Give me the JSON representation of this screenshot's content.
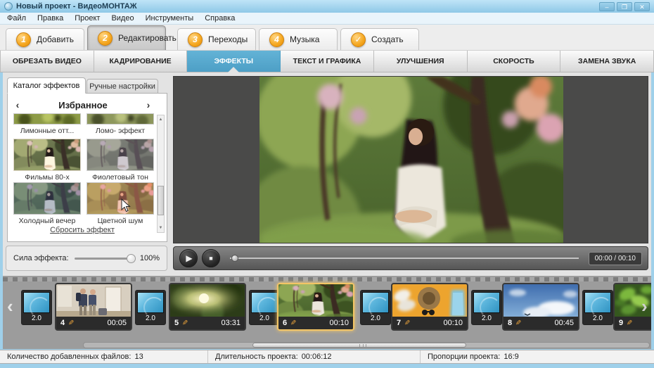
{
  "window": {
    "title": "Новый проект - ВидеоМОНТАЖ",
    "minimize": "–",
    "maximize": "❐",
    "close": "✕"
  },
  "menu": {
    "items": [
      "Файл",
      "Правка",
      "Проект",
      "Видео",
      "Инструменты",
      "Справка"
    ]
  },
  "steps": [
    {
      "badge": "1",
      "label": "Добавить"
    },
    {
      "badge": "2",
      "label": "Редактировать"
    },
    {
      "badge": "3",
      "label": "Переходы"
    },
    {
      "badge": "4",
      "label": "Музыка"
    },
    {
      "badge": "✓",
      "label": "Создать"
    }
  ],
  "subtabs": [
    {
      "label": "ОБРЕЗАТЬ ВИДЕО"
    },
    {
      "label": "КАДРИРОВАНИЕ"
    },
    {
      "label": "ЭФФЕКТЫ"
    },
    {
      "label": "ТЕКСТ И ГРАФИКА"
    },
    {
      "label": "УЛУЧШЕНИЯ"
    },
    {
      "label": "СКОРОСТЬ"
    },
    {
      "label": "ЗАМЕНА ЗВУКА"
    }
  ],
  "effects_panel": {
    "tabs": [
      {
        "label": "Каталог эффектов"
      },
      {
        "label": "Ручные настройки"
      }
    ],
    "category": "Избранное",
    "effects": [
      {
        "label": "Лимонные отт..."
      },
      {
        "label": "Ломо- эффект"
      },
      {
        "label": "Фильмы 80-х"
      },
      {
        "label": "Фиолетовый тон"
      },
      {
        "label": "Холодный вечер"
      },
      {
        "label": "Цветной шум"
      }
    ],
    "reset_link": "Сбросить эффект"
  },
  "strength": {
    "label": "Сила эффекта:",
    "value": "100%"
  },
  "player": {
    "time": "00:00 / 00:10"
  },
  "timeline": {
    "transition_duration": "2.0",
    "clips": [
      {
        "number": "4",
        "duration": "00:05"
      },
      {
        "number": "5",
        "duration": "03:31"
      },
      {
        "number": "6",
        "duration": "00:10",
        "selected": true
      },
      {
        "number": "7",
        "duration": "00:10"
      },
      {
        "number": "8",
        "duration": "00:45"
      },
      {
        "number": "9",
        "duration": ""
      }
    ]
  },
  "statusbar": {
    "files_label": "Количество добавленных файлов:",
    "files_value": "13",
    "duration_label": "Длительность проекта:",
    "duration_value": "00:06:12",
    "aspect_label": "Пропорции проекта:",
    "aspect_value": "16:9"
  },
  "icons": {
    "play": "▶",
    "stop": "■",
    "edit": "✎",
    "chevron_left": "‹",
    "chevron_right": "›",
    "scroll_up": "▲",
    "scroll_down": "▼"
  },
  "colors": {
    "accent_blue": "#4d9fc6",
    "badge_orange": "#f5a71f",
    "selection_orange": "#f3c565",
    "titlebar_blue": "#9fd0ea"
  }
}
